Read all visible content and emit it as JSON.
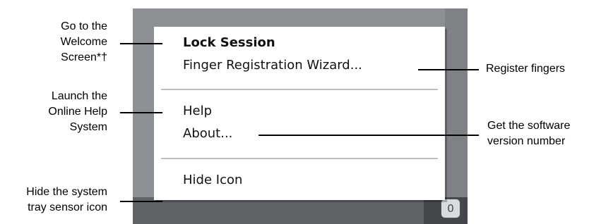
{
  "menu": {
    "items": {
      "lock_session": "Lock Session",
      "finger_registration": "Finger Registration Wizard...",
      "help": "Help",
      "about": "About...",
      "hide_icon": "Hide Icon"
    }
  },
  "tray": {
    "icon_name": "fingerprint-sensor-icon",
    "icon_glyph": "0"
  },
  "annotations": {
    "welcome_screen": [
      "Go to the",
      "Welcome",
      "Screen*†"
    ],
    "online_help": [
      "Launch the",
      "Online Help",
      "System"
    ],
    "hide_sensor": [
      "Hide the system",
      "tray sensor icon"
    ],
    "register_fingers": [
      "Register fingers"
    ],
    "version_number": [
      "Get the software",
      "version number"
    ]
  },
  "colors": {
    "menu_background": "#ffffff",
    "separator": "#bdbdbd",
    "backdrop": "#8c8f93",
    "taskbar": "#5f6368"
  }
}
